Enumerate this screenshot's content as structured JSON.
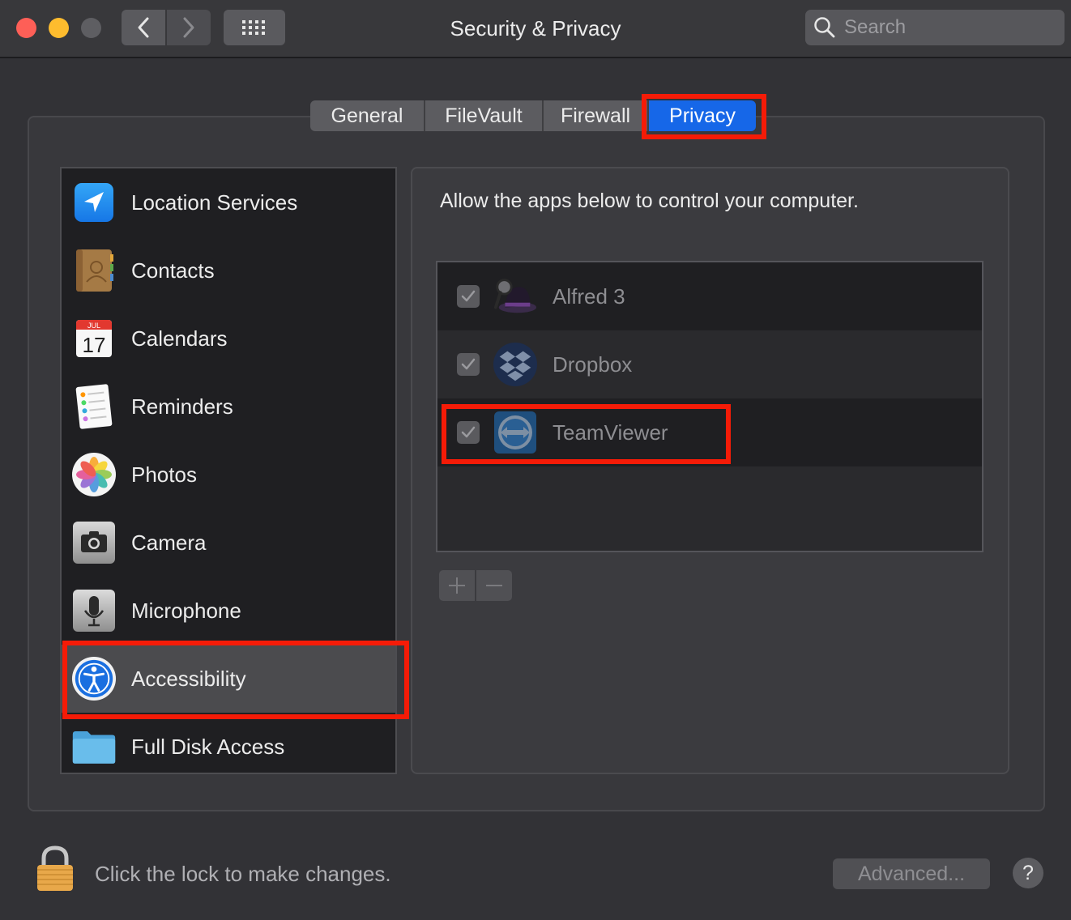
{
  "window": {
    "title": "Security & Privacy",
    "search_placeholder": "Search"
  },
  "tabs": [
    {
      "label": "General"
    },
    {
      "label": "FileVault"
    },
    {
      "label": "Firewall"
    },
    {
      "label": "Privacy",
      "selected": true
    }
  ],
  "sidebar": {
    "items": [
      {
        "label": "Location Services",
        "icon": "location-arrow-icon"
      },
      {
        "label": "Contacts",
        "icon": "contacts-book-icon"
      },
      {
        "label": "Calendars",
        "icon": "calendar-icon",
        "calendar_month": "JUL",
        "calendar_day": "17"
      },
      {
        "label": "Reminders",
        "icon": "reminders-icon"
      },
      {
        "label": "Photos",
        "icon": "photos-flower-icon"
      },
      {
        "label": "Camera",
        "icon": "camera-icon"
      },
      {
        "label": "Microphone",
        "icon": "microphone-icon"
      },
      {
        "label": "Accessibility",
        "icon": "accessibility-icon",
        "selected": true
      },
      {
        "label": "Full Disk Access",
        "icon": "folder-icon"
      }
    ]
  },
  "privacy": {
    "heading": "Allow the apps below to control your computer.",
    "apps": [
      {
        "label": "Alfred 3",
        "checked": true,
        "icon": "alfred-hat-icon"
      },
      {
        "label": "Dropbox",
        "checked": true,
        "icon": "dropbox-icon"
      },
      {
        "label": "TeamViewer",
        "checked": true,
        "icon": "teamviewer-icon"
      }
    ],
    "add_label": "+",
    "remove_label": "−"
  },
  "footer": {
    "lock_text": "Click the lock to make changes.",
    "advanced_label": "Advanced...",
    "help_label": "?"
  },
  "colors": {
    "accent": "#1667e8",
    "highlight": "#f51b07",
    "background": "#323236"
  }
}
